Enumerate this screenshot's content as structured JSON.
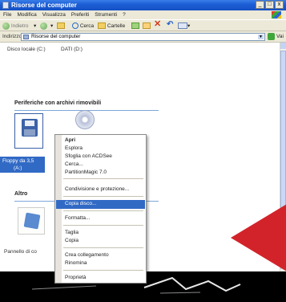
{
  "window": {
    "title": "Risorse del computer",
    "controls": [
      "_",
      "□",
      "x"
    ]
  },
  "menubar": {
    "items": [
      "File",
      "Modifica",
      "Visualizza",
      "Preferiti",
      "Strumenti",
      "?"
    ]
  },
  "toolbar": {
    "back_label": "Indietro",
    "search_label": "Cerca",
    "folders_label": "Cartelle"
  },
  "address": {
    "label": "Indirizzo",
    "value": "Risorse del computer",
    "go_label": "Vai"
  },
  "drives": {
    "c_label": "Disco locale (C:)",
    "d_label": "DATI (D:)"
  },
  "sections": {
    "removable_title": "Periferiche con archivi rimovibili",
    "other_title": "Altro"
  },
  "floppy": {
    "label_line1": "Floppy da 3,5",
    "label_line2": "(A:)"
  },
  "control_panel": {
    "label": "Pannello di co"
  },
  "context_menu": {
    "items": [
      "Apri",
      "Esplora",
      "Sfoglia con ACDSee",
      "Cerca...",
      "PartitionMagic 7.0",
      "Condivisione e protezione...",
      "Copia disco...",
      "Formatta...",
      "Taglia",
      "Copia",
      "Crea collegamento",
      "Rinomina",
      "Proprietà"
    ],
    "highlighted_index": 6
  },
  "colors": {
    "titlebar": "#1d5fd6",
    "selection": "#316ac5",
    "arrow": "#d3232a"
  }
}
